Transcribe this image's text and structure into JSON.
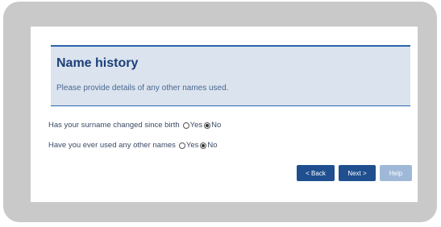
{
  "form": {
    "title": "Name history",
    "subtitle": "Please provide details of any other names used.",
    "questions": [
      {
        "label": "Has your surname changed since birth",
        "options": [
          {
            "label": "Yes",
            "checked": false
          },
          {
            "label": "No",
            "checked": true
          }
        ]
      },
      {
        "label": "Have you ever used any other names",
        "options": [
          {
            "label": "Yes",
            "checked": false
          },
          {
            "label": "No",
            "checked": true
          }
        ]
      }
    ],
    "buttons": {
      "back": "< Back",
      "next": "Next >",
      "help": "Help"
    }
  }
}
